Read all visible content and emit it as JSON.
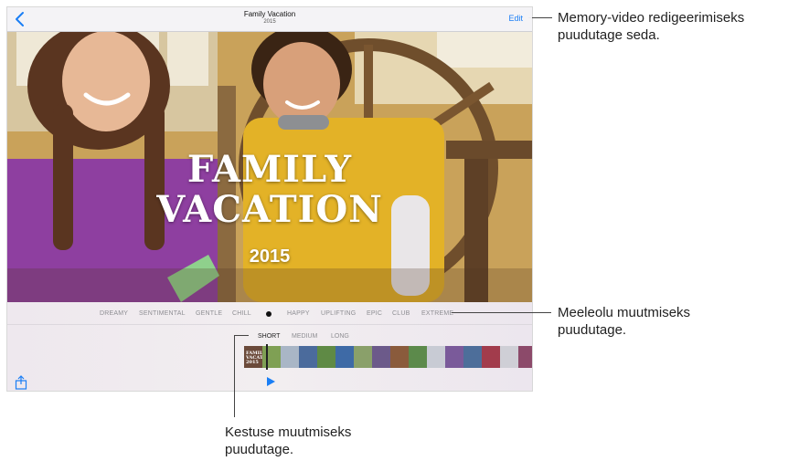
{
  "navbar": {
    "title": "Family Vacation",
    "subtitle": "2015",
    "edit_label": "Edit"
  },
  "photo": {
    "title_line1": "FAMILY",
    "title_line2": "VACATION",
    "year": "2015"
  },
  "moods": {
    "items": [
      "DREAMY",
      "SENTIMENTAL",
      "GENTLE",
      "CHILL",
      "HAPPY",
      "UPLIFTING",
      "EPIC",
      "CLUB",
      "EXTREME"
    ]
  },
  "durations": {
    "items": [
      "SHORT",
      "MEDIUM",
      "LONG"
    ],
    "selected": "SHORT"
  },
  "filmstrip": {
    "first_thumb_text": "FAMILY VACATION 2015"
  },
  "callouts": {
    "edit_line1": "Memory-video redigeerimiseks",
    "edit_line2": "puudutage seda.",
    "mood_line1": "Meeleolu muutmiseks",
    "mood_line2": "puudutage.",
    "duration_line1": "Kestuse muutmiseks",
    "duration_line2": "puudutage."
  },
  "colors": {
    "accent": "#1a7ef5",
    "label_gray": "#8e8e93"
  }
}
